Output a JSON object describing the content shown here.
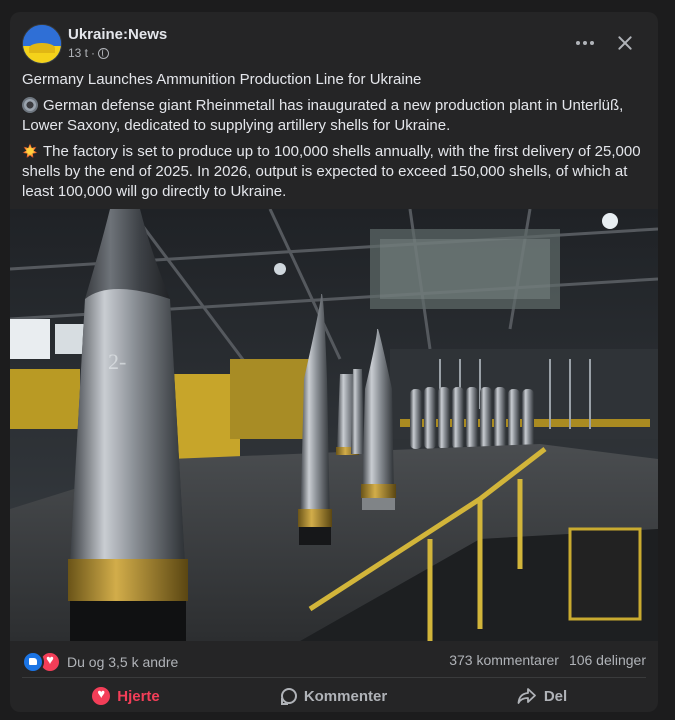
{
  "post": {
    "author": "Ukraine:News",
    "timestamp": "13 t",
    "separator": "·",
    "audience_icon": "globe-icon",
    "menu_icon": "more-options-icon",
    "close_icon": "close-icon",
    "headline": "Germany Launches Ammunition Production Line for Ukraine",
    "paragraph_1": "German defense giant Rheinmetall has inaugurated a new production plant in Unterlüß, Lower Saxony, dedicated to supplying artillery shells for Ukraine.",
    "paragraph_1_icon": "gear-emoji",
    "paragraph_2": "The factory is set to produce up to 100,000 shells annually, with the first delivery of 25,000 shells by the end of 2025. In 2026, output is expected to exceed 150,000 shells, of which at least 100,000 will go directly to Ukraine.",
    "paragraph_2_icon": "collision-emoji",
    "photo_text": "2-"
  },
  "stats": {
    "reactions_text": "Du og 3,5 k andre",
    "comments": "373 kommentarer",
    "shares": "106 delinger"
  },
  "actions": {
    "love_label": "Hjerte",
    "comment_label": "Kommenter",
    "share_label": "Del"
  },
  "colors": {
    "background": "#1c1c1d",
    "card": "#252526",
    "text": "#e4e6eb",
    "muted": "#b0b3b8",
    "like": "#1b74e4",
    "love": "#f33e58"
  }
}
